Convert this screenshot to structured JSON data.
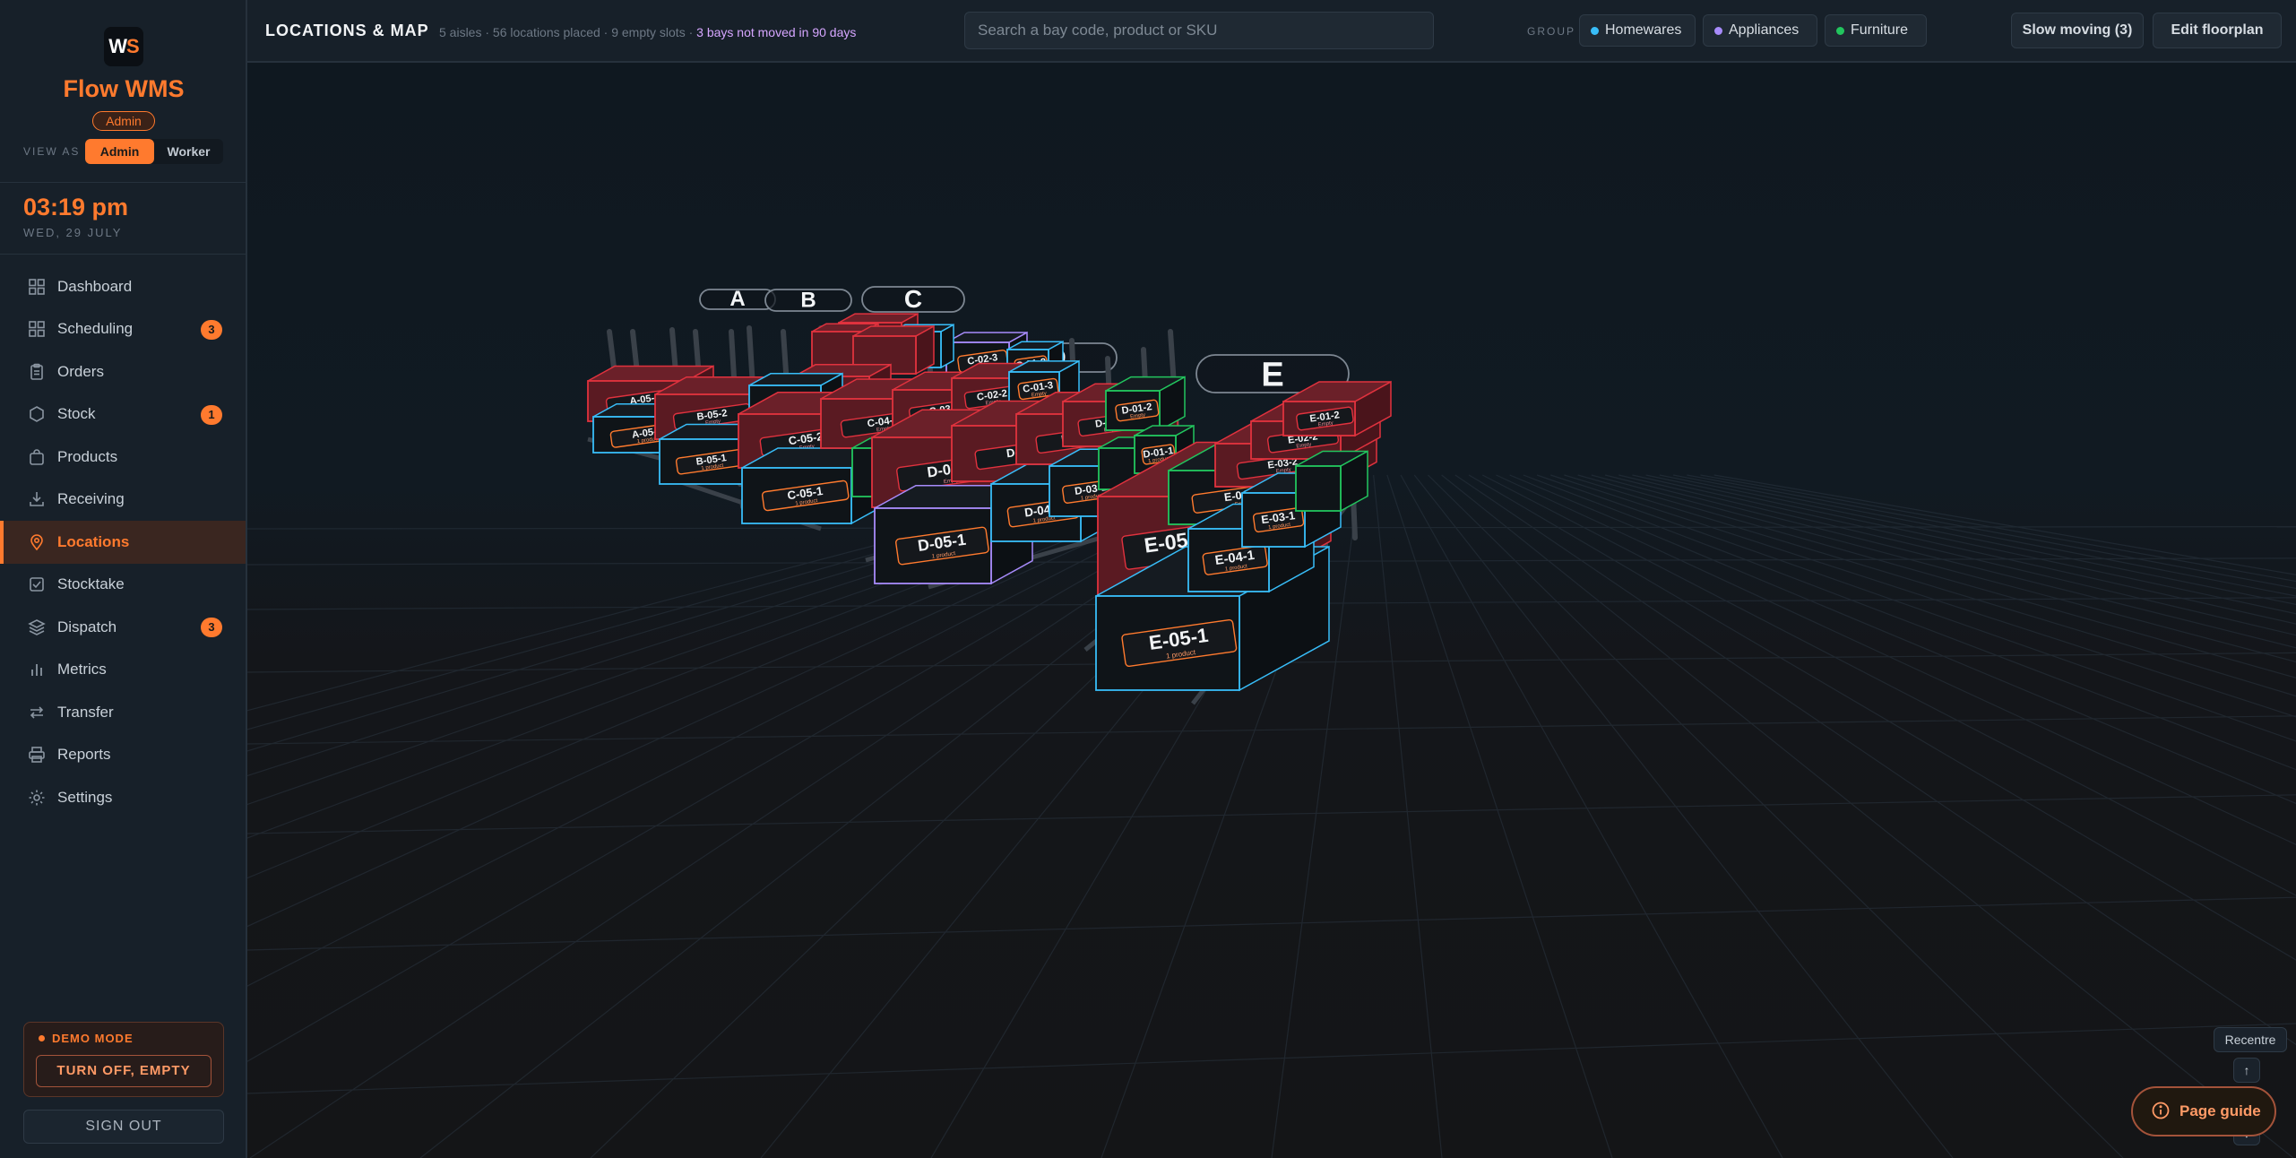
{
  "brand": {
    "logo_text": "WS",
    "name": "Flow WMS",
    "role_badge": "Admin"
  },
  "view_as": {
    "label": "VIEW AS",
    "options": [
      "Admin",
      "Worker"
    ],
    "selected": "Admin"
  },
  "clock": {
    "time": "03:19 pm",
    "date": "WED, 29 JULY"
  },
  "nav": {
    "items": [
      {
        "label": "Dashboard",
        "icon": "grid-icon"
      },
      {
        "label": "Scheduling",
        "icon": "grid-icon",
        "badge": "3"
      },
      {
        "label": "Orders",
        "icon": "clipboard-icon"
      },
      {
        "label": "Stock",
        "icon": "hexagon-icon",
        "badge": "1"
      },
      {
        "label": "Products",
        "icon": "bag-icon"
      },
      {
        "label": "Receiving",
        "icon": "inbox-download-icon"
      },
      {
        "label": "Locations",
        "icon": "map-pin-icon",
        "active": true
      },
      {
        "label": "Stocktake",
        "icon": "checklist-icon"
      },
      {
        "label": "Dispatch",
        "icon": "layers-icon",
        "badge": "3"
      },
      {
        "label": "Metrics",
        "icon": "bar-chart-icon"
      },
      {
        "label": "Transfer",
        "icon": "arrows-swap-icon"
      },
      {
        "label": "Reports",
        "icon": "printer-icon"
      },
      {
        "label": "Settings",
        "icon": "gear-icon"
      }
    ]
  },
  "demo": {
    "label": "DEMO MODE",
    "button": "TURN OFF, EMPTY"
  },
  "signout": "SIGN OUT",
  "topbar": {
    "title": "LOCATIONS & MAP",
    "summary": "5 aisles · 56 locations placed · 9 empty slots · ",
    "summary_highlight": "3 bays not moved in 90 days",
    "search_placeholder": "Search a bay code, product or SKU",
    "group_label": "GROUP",
    "groups": [
      {
        "label": "Homewares",
        "color": "#38bdf8"
      },
      {
        "label": "Appliances",
        "color": "#a78bfa"
      },
      {
        "label": "Furniture",
        "color": "#22c55e"
      }
    ],
    "slow_moving": "Slow moving (3)",
    "edit_floorplan": "Edit floorplan"
  },
  "scene": {
    "aisles": [
      "A",
      "B",
      "C",
      "D",
      "E"
    ],
    "bay_labels": {
      "A-05-2": "Empty",
      "A-05-1": "1 product",
      "B-05-2": "Empty",
      "B-05-1": "1 product",
      "C-05-2": "Empty",
      "C-05-1": "1 product",
      "C-04-2": "Empty",
      "C-03-2": "Empty",
      "C-02-3": "Empty",
      "C-02-2": "Empty",
      "C-01-3": "Empty",
      "C-01-2": "Empty",
      "D-05-2": "Empty",
      "D-05-1": "1 product",
      "D-04-2": "Empty",
      "D-04-1": "1 product",
      "D-03-2": "Empty",
      "D-03-1": "1 product",
      "D-02-2": "Empty",
      "D-01-2": "Empty",
      "D-01-1": "1 product",
      "E-05-2": "Empty",
      "E-05-1": "1 product",
      "E-04-2": "Empty",
      "E-04-1": "1 product",
      "E-03-2": "Empty",
      "E-03-1": "1 product",
      "E-02-2": "Empty",
      "E-01-2": "Empty"
    },
    "controls": {
      "recentre": "Recentre",
      "up": "↑",
      "down": "↓"
    },
    "page_guide": "Page guide"
  },
  "colors": {
    "accent": "#ff7a2e",
    "empty_bay": "#e0323e",
    "homewares": "#38bdf8",
    "appliances": "#a78bfa",
    "furniture": "#22c55e"
  }
}
